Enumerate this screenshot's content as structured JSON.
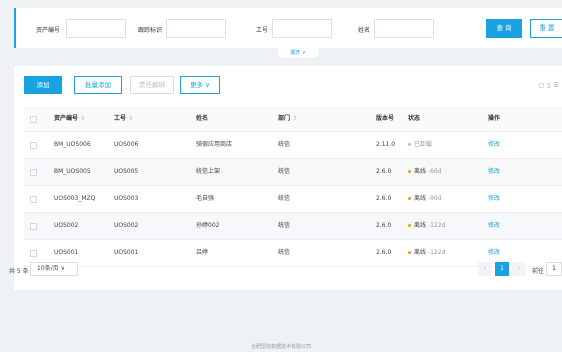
{
  "filters": {
    "fields": [
      {
        "label": "资产编号",
        "value": ""
      },
      {
        "label": "跟踪标识",
        "value": ""
      },
      {
        "label": "工号",
        "value": ""
      },
      {
        "label": "姓名",
        "value": ""
      }
    ],
    "query_label": "查 询",
    "reset_label": "重 置",
    "collapse_label": "展开 ∨"
  },
  "toolbar": {
    "add_label": "添加",
    "batch_add_label": "批量添加",
    "unbind_label": "责任解绑",
    "more_label": "更多 ∨",
    "icons": [
      "refresh-icon",
      "delete-icon",
      "column-settings-icon"
    ]
  },
  "table": {
    "columns": [
      "资产编号",
      "工号",
      "姓名",
      "部门",
      "版本号",
      "状态",
      "操作"
    ],
    "sortable": [
      true,
      true,
      false,
      true,
      false,
      false,
      false
    ],
    "rows": [
      {
        "asset_no": "BM_UOS006",
        "emp_no": "UOS006",
        "name": "骑宿应用商店",
        "dept": "统信",
        "version": "2.11.0",
        "status": "已卸载",
        "status_color": "#bbbbbb",
        "status_extra": "",
        "action": "修改"
      },
      {
        "asset_no": "BM_UOS005",
        "emp_no": "UOS005",
        "name": "统信上架",
        "dept": "统信",
        "version": "2.6.0",
        "status": "离线",
        "status_color": "#f0a020",
        "status_extra": "-66d",
        "action": "修改"
      },
      {
        "asset_no": "UOS003_MZQ",
        "emp_no": "UOS003",
        "name": "毛自强",
        "dept": "统信",
        "version": "2.6.0",
        "status": "离线",
        "status_color": "#f0a020",
        "status_extra": "-99d",
        "action": "修改"
      },
      {
        "asset_no": "UOS002",
        "emp_no": "UOS002",
        "name": "孙婷002",
        "dept": "统信",
        "version": "2.6.0",
        "status": "离线",
        "status_color": "#f0a020",
        "status_extra": "-122d",
        "action": "修改"
      },
      {
        "asset_no": "UOS001",
        "emp_no": "UOS001",
        "name": "吕婷",
        "dept": "统信",
        "version": "2.6.0",
        "status": "离线",
        "status_color": "#f0a020",
        "status_extra": "-122d",
        "action": "修改"
      }
    ]
  },
  "pagination": {
    "total": "共 5 条",
    "page_size": "10条/页 ∨",
    "prev": "‹",
    "current_page": "1",
    "next": "›",
    "goto_label": "前往",
    "goto_value": "1"
  },
  "footer": "合肥国信数据技术有限公司",
  "colors": {
    "accent": "#1aa3e0",
    "offline": "#f0a020",
    "uninstalled": "#bbbbbb"
  }
}
